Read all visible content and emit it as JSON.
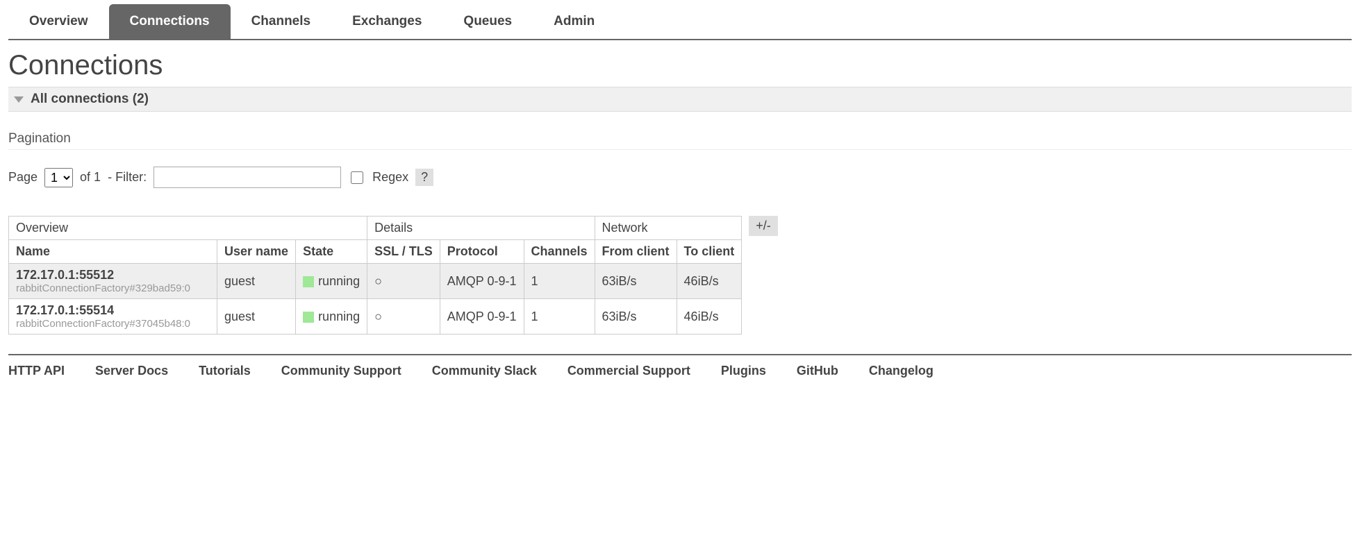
{
  "tabs": {
    "overview": "Overview",
    "connections": "Connections",
    "channels": "Channels",
    "exchanges": "Exchanges",
    "queues": "Queues",
    "admin": "Admin"
  },
  "page_title": "Connections",
  "section_header": "All connections (2)",
  "pagination": {
    "label": "Pagination",
    "page_label_pre": "Page",
    "page_select": "1",
    "total_pages": "of 1",
    "filter_label": "- Filter:",
    "filter_value": "",
    "regex_label": "Regex",
    "help": "?"
  },
  "table": {
    "groups": {
      "overview": "Overview",
      "details": "Details",
      "network": "Network"
    },
    "columns": {
      "name": "Name",
      "user": "User name",
      "state": "State",
      "ssl": "SSL / TLS",
      "protocol": "Protocol",
      "channels": "Channels",
      "from_client": "From client",
      "to_client": "To client"
    },
    "rows": [
      {
        "name": "172.17.0.1:55512",
        "sub": "rabbitConnectionFactory#329bad59:0",
        "user": "guest",
        "state": "running",
        "ssl": "○",
        "protocol": "AMQP 0-9-1",
        "channels": "1",
        "from_client": "63iB/s",
        "to_client": "46iB/s"
      },
      {
        "name": "172.17.0.1:55514",
        "sub": "rabbitConnectionFactory#37045b48:0",
        "user": "guest",
        "state": "running",
        "ssl": "○",
        "protocol": "AMQP 0-9-1",
        "channels": "1",
        "from_client": "63iB/s",
        "to_client": "46iB/s"
      }
    ],
    "plusminus": "+/-"
  },
  "footer": {
    "http_api": "HTTP API",
    "server_docs": "Server Docs",
    "tutorials": "Tutorials",
    "community_support": "Community Support",
    "community_slack": "Community Slack",
    "commercial_support": "Commercial Support",
    "plugins": "Plugins",
    "github": "GitHub",
    "changelog": "Changelog"
  }
}
